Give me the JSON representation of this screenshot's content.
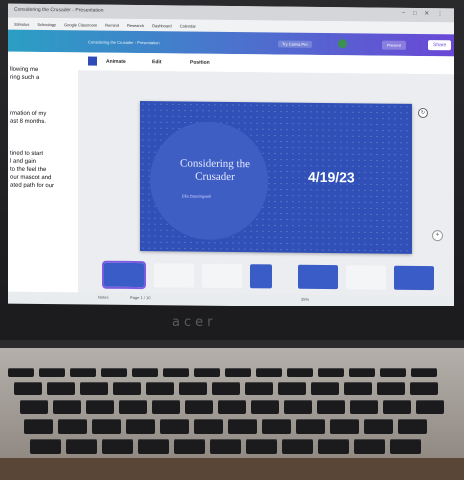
{
  "browser": {
    "tab_title": "Considering the Crusader - Presentation",
    "window_controls": "− □ ✕ ⋮",
    "bookmarks": [
      "Stimulus",
      "Schoology",
      "Google Classroom",
      "Remind",
      "Research",
      "Dashboard",
      "Calendar"
    ]
  },
  "editor": {
    "doc_title": "Considering the Crusader - Presentation",
    "try_pro": "Try Canva Pro",
    "present_label": "Present",
    "share_label": "Share",
    "toolbar": {
      "animate": "Animate",
      "edit": "Edit",
      "position": "Position"
    },
    "colors": {
      "slide_bg": "#3050b8",
      "header_start": "#2b9fc4",
      "header_end": "#6a48d6"
    }
  },
  "left_panel": {
    "lines": [
      "llowing me",
      "ring such a",
      "",
      "rmation of my",
      "ast 8 months.",
      "",
      "tined to start",
      "l and gain",
      "to the feel the",
      "our mascot and",
      "ated path for our"
    ]
  },
  "slide": {
    "title": "Considering the Crusader",
    "name": "Ella Dassingwell",
    "date": "4/19/23"
  },
  "status": {
    "notes": "Notes",
    "pages": "Page 1 / 10",
    "zoom": "35%"
  },
  "device": {
    "brand": "acer"
  }
}
